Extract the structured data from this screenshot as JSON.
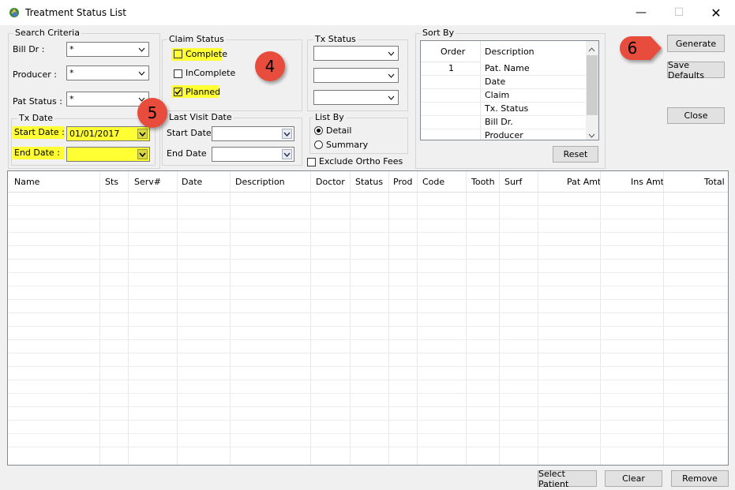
{
  "window": {
    "title": "Treatment Status List"
  },
  "search_criteria": {
    "group_label": "Search Criteria",
    "bill_dr_label": "Bill Dr :",
    "bill_dr_value": "*",
    "producer_label": "Producer :",
    "producer_value": "*",
    "pat_status_label": "Pat Status :",
    "pat_status_value": "*"
  },
  "tx_date": {
    "group_label": "Tx Date",
    "start_label": "Start Date :",
    "start_value": "01/01/2017",
    "end_label": "End Date :",
    "end_value": ""
  },
  "claim_status": {
    "group_label": "Claim Status",
    "complete_label": "Complete",
    "incomplete_label": "InComplete",
    "planned_label": "Planned"
  },
  "last_visit": {
    "group_label": "Last Visit Date",
    "start_label": "Start Date",
    "end_label": "End Date"
  },
  "tx_status": {
    "group_label": "Tx Status"
  },
  "list_by": {
    "group_label": "List By",
    "detail_label": "Detail",
    "summary_label": "Summary"
  },
  "exclude_ortho_label": "Exclude Ortho Fees",
  "sort_by": {
    "group_label": "Sort By",
    "col_order": "Order",
    "col_description": "Description",
    "rows": [
      {
        "order": "1",
        "description": "Pat. Name"
      },
      {
        "order": "",
        "description": "Date"
      },
      {
        "order": "",
        "description": "Claim"
      },
      {
        "order": "",
        "description": "Tx. Status"
      },
      {
        "order": "",
        "description": "Bill Dr."
      },
      {
        "order": "",
        "description": "Producer"
      }
    ],
    "reset_label": "Reset"
  },
  "buttons": {
    "generate": "Generate",
    "save_defaults": "Save Defaults",
    "close": "Close",
    "select_patient": "Select Patient",
    "clear": "Clear",
    "remove": "Remove"
  },
  "annotations": {
    "a4": "4",
    "a5": "5",
    "a6": "6"
  },
  "grid": {
    "columns": [
      "Name",
      "Sts",
      "Serv#",
      "Date",
      "Description",
      "Doctor",
      "Status",
      "Prod",
      "Code",
      "Tooth",
      "Surf",
      "Pat Amt",
      "Ins Amt",
      "Total"
    ]
  },
  "colors": {
    "highlight": "#ffff33",
    "badge": "#e74c3c"
  }
}
